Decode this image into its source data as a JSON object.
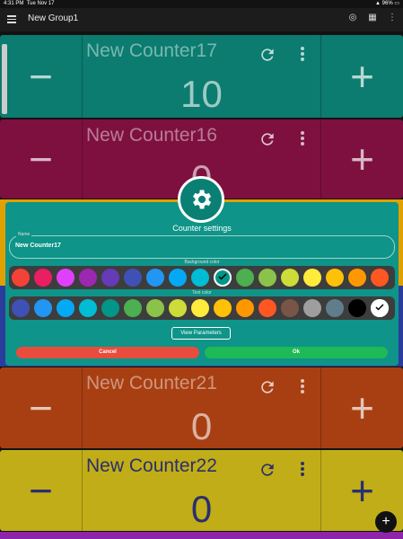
{
  "status_bar": {
    "time": "4:31 PM",
    "date": "Tue Nov 17",
    "battery": "96%"
  },
  "app_bar": {
    "title": "New Group1",
    "icons": [
      "menu-icon",
      "target-icon",
      "grid-icon",
      "more-vert-icon"
    ]
  },
  "counters": [
    {
      "name": "New Counter17",
      "value": "10",
      "color": "#0b7c6f"
    },
    {
      "name": "New Counter16",
      "value": "0",
      "color": "#7e1040"
    },
    {
      "name": "New Counter21",
      "value": "0",
      "color": "#a83f12"
    },
    {
      "name": "New Counter22",
      "value": "0",
      "color": "#c1ad17"
    }
  ],
  "counter_controls": {
    "minus": "−",
    "plus": "+"
  },
  "dialog": {
    "title": "Counter settings",
    "name_label": "Name",
    "name_value": "New Counter17",
    "background_label": "Background color",
    "text_label": "Text color",
    "background_colors": [
      "#f44336",
      "#e91e63",
      "#e040fb",
      "#9c27b0",
      "#673ab7",
      "#3f51b5",
      "#2196f3",
      "#03a9f4",
      "#00bcd4",
      "#009688",
      "#4caf50",
      "#8bc34a",
      "#cddc39",
      "#ffeb3b",
      "#ffc107",
      "#ff9800",
      "#ff5722"
    ],
    "background_selected": 9,
    "text_colors": [
      "#3f51b5",
      "#2196f3",
      "#03a9f4",
      "#00bcd4",
      "#009688",
      "#4caf50",
      "#8bc34a",
      "#cddc39",
      "#ffeb3b",
      "#ffc107",
      "#ff9800",
      "#ff5722",
      "#795548",
      "#9e9e9e",
      "#607d8b",
      "#000000",
      "#ffffff"
    ],
    "text_selected": 16,
    "params_button": "View Parameters",
    "cancel": "Cancel",
    "ok": "Ok"
  },
  "fab": "+"
}
